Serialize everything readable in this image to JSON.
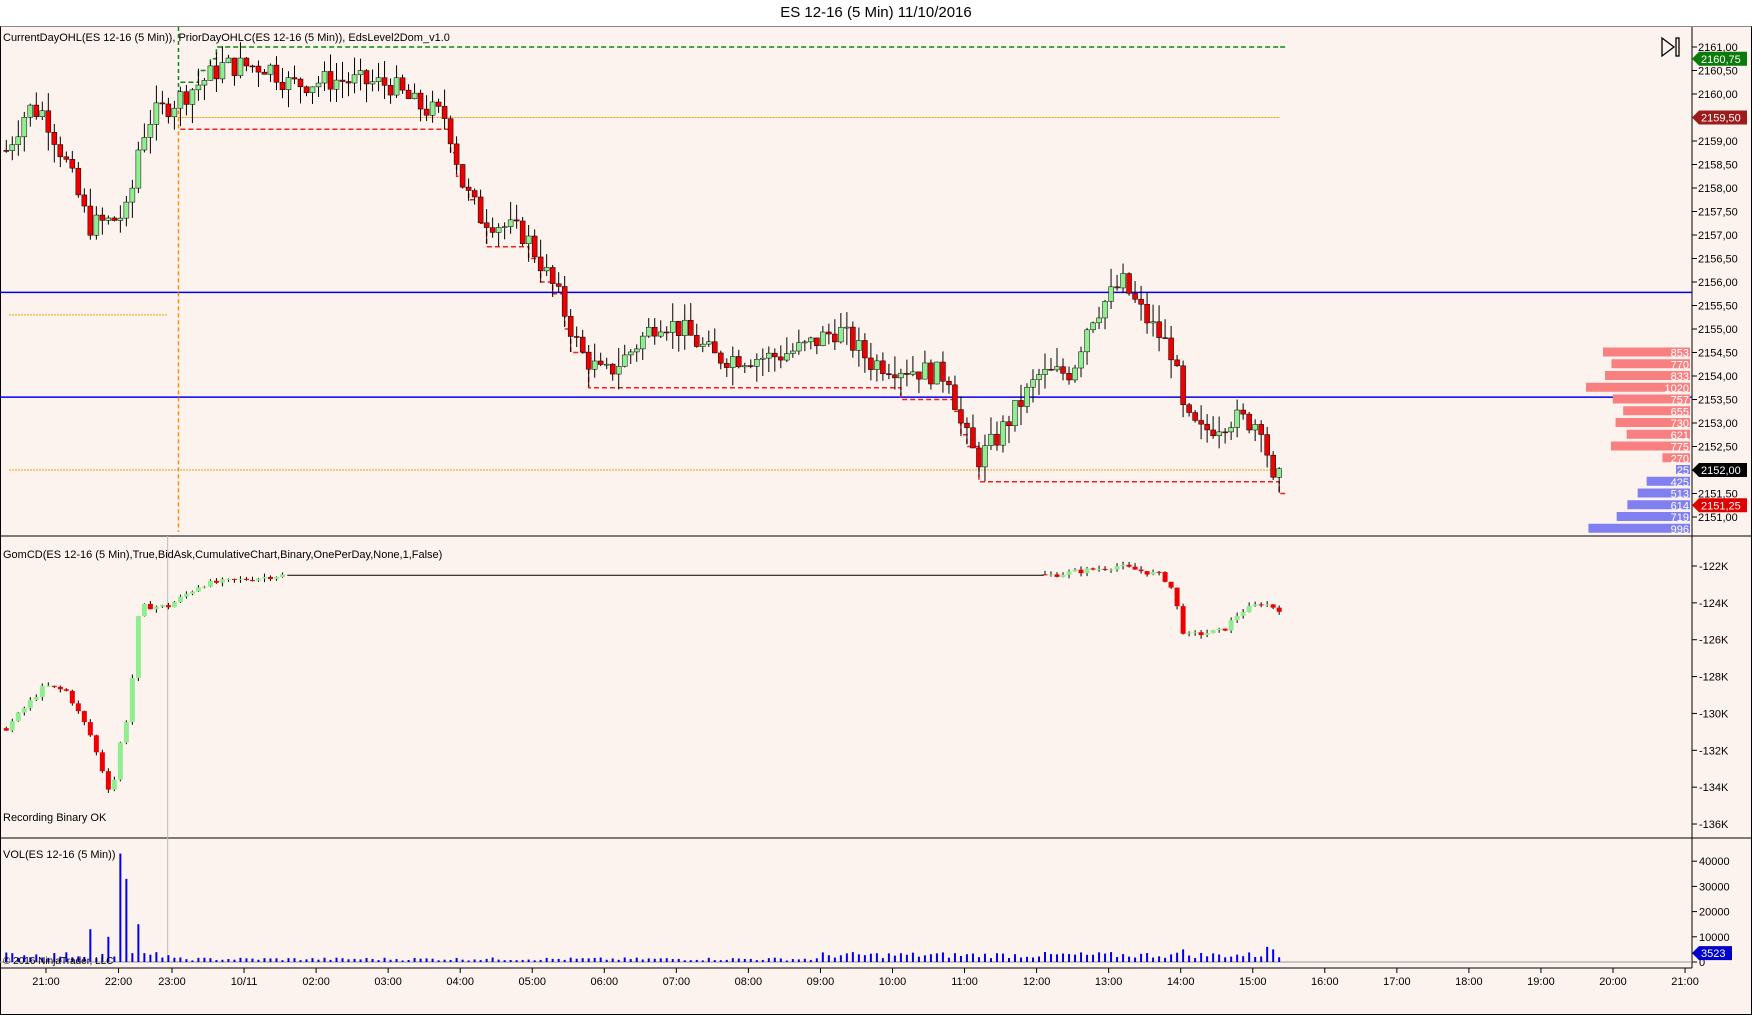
{
  "window": {
    "title": "ES 12-16 (5 Min)  11/10/2016"
  },
  "price_panel": {
    "indicators_label": "CurrentDayOHL(ES 12-16 (5 Min)), PriorDayOHLC(ES 12-16 (5 Min)), EdsLevel2Dom_v1.0",
    "axis_ticks": [
      "2161,00",
      "2160,50",
      "2160,00",
      "2159,50",
      "2159,00",
      "2158,50",
      "2158,00",
      "2157,50",
      "2157,00",
      "2156,50",
      "2156,00",
      "2155,50",
      "2155,00",
      "2154,50",
      "2154,00",
      "2153,50",
      "2153,00",
      "2152,50",
      "2152,00",
      "2151,50",
      "2151,00"
    ],
    "price_tags": [
      {
        "label": "2160,75",
        "value": 2160.75,
        "color": "#0a7a0a"
      },
      {
        "label": "2159,50",
        "value": 2159.5,
        "color": "#9c1c1c"
      },
      {
        "label": "2152,00",
        "value": 2152.0,
        "color": "#000000"
      },
      {
        "label": "2151,25",
        "value": 2151.25,
        "color": "#e00000"
      }
    ],
    "horizontal_lines": [
      2155.78,
      2153.55
    ],
    "dom_asks": [
      {
        "price": 2154.5,
        "size": "853"
      },
      {
        "price": 2154.25,
        "size": "770"
      },
      {
        "price": 2154.0,
        "size": "833"
      },
      {
        "price": 2153.75,
        "size": "1020"
      },
      {
        "price": 2153.5,
        "size": "757"
      },
      {
        "price": 2153.25,
        "size": "655"
      },
      {
        "price": 2153.0,
        "size": "730"
      },
      {
        "price": 2152.75,
        "size": "621"
      },
      {
        "price": 2152.5,
        "size": "775"
      },
      {
        "price": 2152.25,
        "size": "270"
      }
    ],
    "dom_bids": [
      {
        "price": 2152.0,
        "size": "25"
      },
      {
        "price": 2151.75,
        "size": "425"
      },
      {
        "price": 2151.5,
        "size": "513"
      },
      {
        "price": 2151.25,
        "size": "614"
      },
      {
        "price": 2151.0,
        "size": "719"
      },
      {
        "price": 2150.75,
        "size": "996"
      }
    ]
  },
  "delta_panel": {
    "indicator_label": "GomCD(ES 12-16 (5 Min),True,BidAsk,CumulativeChart,Binary,OnePerDay,None,1,False)",
    "status": "Recording Binary OK",
    "axis_ticks": [
      "-122K",
      "-124K",
      "-126K",
      "-128K",
      "-130K",
      "-132K",
      "-134K",
      "-136K"
    ]
  },
  "volume_panel": {
    "indicator_label": "VOL(ES 12-16 (5 Min))",
    "axis_ticks": [
      "40000",
      "30000",
      "20000",
      "10000",
      "0"
    ],
    "last_volume": "3523",
    "copyright": "© 2016 NinjaTrader, LLC"
  },
  "time_axis": [
    "21:00",
    "22:00",
    "23:00",
    "10/11",
    "02:00",
    "03:00",
    "04:00",
    "05:00",
    "06:00",
    "07:00",
    "08:00",
    "09:00",
    "10:00",
    "11:00",
    "12:00",
    "13:00",
    "14:00",
    "15:00",
    "16:00",
    "17:00",
    "18:00",
    "19:00",
    "20:00",
    "21:00"
  ],
  "colors": {
    "up": "#90ee90",
    "down": "#ee0000",
    "background": "#fdf3ee",
    "level": "#0000ee",
    "volume": "#0000ee"
  },
  "chart_data": {
    "type": "candlestick",
    "x_unit": "hours since 23:00 axis label",
    "price_close_path": [
      [
        -2.3,
        2158.8
      ],
      [
        -2.0,
        2159.7
      ],
      [
        -1.77,
        2159.6
      ],
      [
        -1.46,
        2158.5
      ],
      [
        -1.15,
        2157.2
      ],
      [
        -0.84,
        2157.3
      ],
      [
        -0.6,
        2157.5
      ],
      [
        -0.45,
        2159.0
      ],
      [
        -0.29,
        2159.5
      ],
      [
        0.09,
        2159.9
      ],
      [
        0.71,
        2160.6
      ],
      [
        1.33,
        2160.6
      ],
      [
        1.64,
        2160.2
      ],
      [
        2.26,
        2160.3
      ],
      [
        3.04,
        2160.2
      ],
      [
        3.35,
        2159.8
      ],
      [
        3.81,
        2159.5
      ],
      [
        4.05,
        2158.0
      ],
      [
        4.28,
        2157.4
      ],
      [
        4.9,
        2157.0
      ],
      [
        5.05,
        2156.6
      ],
      [
        5.36,
        2155.7
      ],
      [
        5.67,
        2154.5
      ],
      [
        5.99,
        2154.0
      ],
      [
        6.29,
        2154.4
      ],
      [
        6.76,
        2155.2
      ],
      [
        7.07,
        2155.0
      ],
      [
        7.53,
        2154.4
      ],
      [
        8.31,
        2154.4
      ],
      [
        8.77,
        2154.6
      ],
      [
        9.24,
        2155.0
      ],
      [
        9.7,
        2154.3
      ],
      [
        10.79,
        2154.0
      ],
      [
        10.94,
        2153.0
      ],
      [
        11.17,
        2152.2
      ],
      [
        11.41,
        2152.6
      ],
      [
        11.72,
        2153.3
      ],
      [
        12.03,
        2154.0
      ],
      [
        12.49,
        2154.1
      ],
      [
        12.73,
        2155.2
      ],
      [
        12.96,
        2155.6
      ],
      [
        13.19,
        2156.0
      ],
      [
        13.35,
        2155.6
      ],
      [
        13.58,
        2155.1
      ],
      [
        13.89,
        2154.5
      ],
      [
        14.05,
        2153.1
      ],
      [
        14.28,
        2152.8
      ],
      [
        14.67,
        2153.1
      ],
      [
        15.13,
        2153.0
      ],
      [
        15.29,
        2151.6
      ],
      [
        15.41,
        2151.9
      ]
    ],
    "price_range": [
      2150.7,
      2161.3
    ],
    "delta_path_k": [
      [
        -2.3,
        -130.8
      ],
      [
        -1.77,
        -128.5
      ],
      [
        -1.46,
        -128.8
      ],
      [
        -1.15,
        -131
      ],
      [
        -0.84,
        -134.5
      ],
      [
        -0.69,
        -131
      ],
      [
        -0.6,
        -130
      ],
      [
        -0.45,
        -124.2
      ],
      [
        -0.06,
        -124.2
      ],
      [
        0.4,
        -123
      ],
      [
        1.5,
        -122.5
      ],
      [
        12.19,
        -122.5
      ],
      [
        13.12,
        -122
      ],
      [
        13.74,
        -122.5
      ],
      [
        13.89,
        -123.3
      ],
      [
        14.05,
        -125.8
      ],
      [
        14.59,
        -125.5
      ],
      [
        14.82,
        -124.5
      ],
      [
        15.13,
        -124
      ],
      [
        15.41,
        -124.4
      ]
    ],
    "delta_range_k": [
      -137,
      -121
    ],
    "volume_spikes": [
      [
        -1.15,
        13000
      ],
      [
        -0.87,
        10000
      ],
      [
        -0.75,
        43000
      ],
      [
        -0.67,
        33000
      ],
      [
        -0.49,
        15000
      ],
      [
        14.05,
        5000
      ],
      [
        15.2,
        6000
      ],
      [
        15.29,
        5000
      ]
    ],
    "volume_range": [
      0,
      45000
    ],
    "prior_day_levels": {
      "high": 2160.75,
      "mid": 2159.5,
      "close": 2152.0,
      "other": 2155.3
    }
  }
}
